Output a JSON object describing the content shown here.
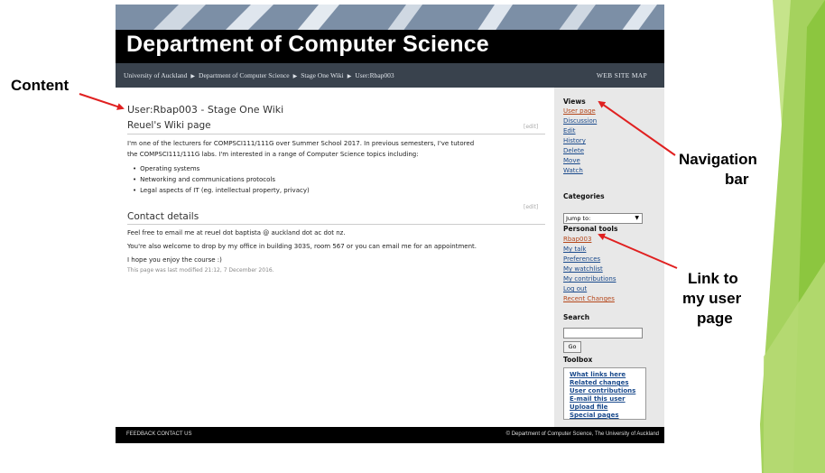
{
  "callouts": {
    "content": "Content",
    "navigation_bar_line1": "Navigation",
    "navigation_bar_line2": "bar",
    "link_line1": "Link to",
    "link_line2": "my user",
    "link_line3": "page"
  },
  "site": {
    "title": "Department of Computer Science",
    "breadcrumbs": [
      "University of Auckland",
      "Department of Computer Science",
      "Stage One Wiki",
      "User:Rbap003"
    ],
    "site_map": "WEB SITE MAP"
  },
  "content": {
    "page_title": "User:Rbap003 - Stage One Wiki",
    "edit_label": "[edit]",
    "wiki_heading": "Reuel's Wiki page",
    "intro_line1": "I'm one of the lecturers for COMPSCI111/111G over Summer School 2017. In previous semesters, I've tutored",
    "intro_line2": "the COMPSCI111/111G labs. I'm interested in a range of Computer Science topics including:",
    "bullets": [
      "Operating systems",
      "Networking and communications protocols",
      "Legal aspects of IT (eg. intellectual property, privacy)"
    ],
    "contact_heading": "Contact details",
    "contact_line1": "Feel free to email me at reuel dot baptista @ auckland dot ac dot nz.",
    "contact_line2": "You're also welcome to drop by my office in building 303S, room 567 or you can email me for an appointment.",
    "contact_line3": "I hope you enjoy the course :)",
    "last_modified": "This page was last modified 21:12, 7 December 2016."
  },
  "sidebar": {
    "views_heading": "Views",
    "views": [
      "User page",
      "Discussion",
      "Edit",
      "History",
      "Delete",
      "Move",
      "Watch"
    ],
    "categories_heading": "Categories",
    "jump_to": "Jump to:",
    "personal_heading": "Personal tools",
    "personal": [
      "Rbap003",
      "My talk",
      "Preferences",
      "My watchlist",
      "My contributions",
      "Log out",
      "Recent Changes"
    ],
    "search_heading": "Search",
    "go_label": "Go",
    "toolbox_heading": "Toolbox",
    "toolbox": [
      "What links here",
      "Related changes",
      "User contributions",
      "E-mail this user",
      "Upload file",
      "Special pages"
    ]
  },
  "footer": {
    "left": "FEEDBACK  CONTACT US",
    "right": "© Department of Computer Science, The University of Auckland"
  },
  "colors": {
    "deco_green": "#8cc63f",
    "deco_light": "#c6e48b",
    "arrow_red": "#e02020",
    "link_blue": "#1a4a8c",
    "crumb_bar": "#39424d"
  }
}
